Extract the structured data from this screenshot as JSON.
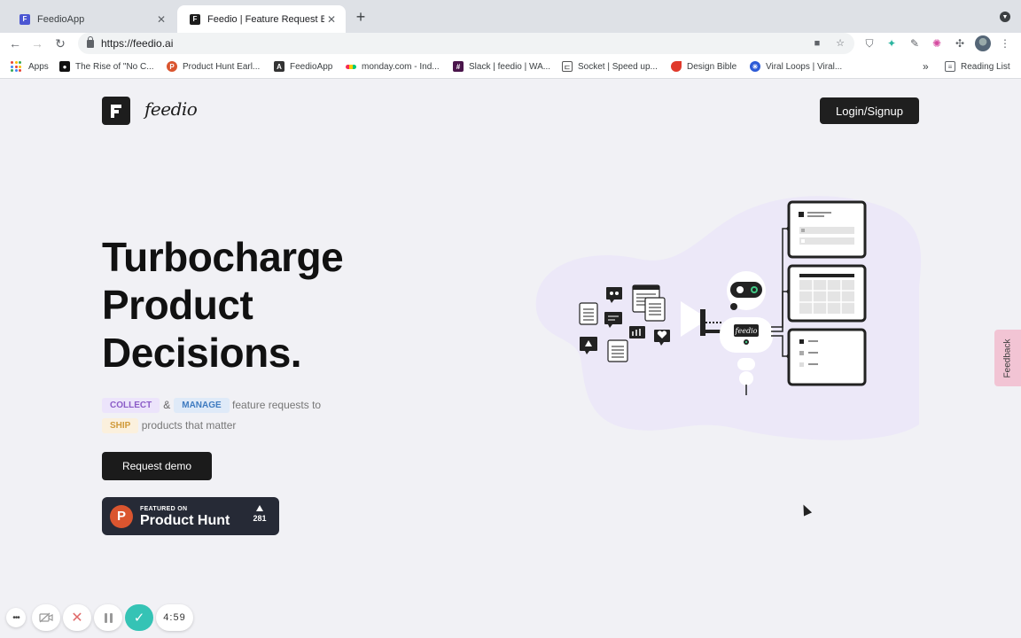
{
  "browser": {
    "tabs": [
      {
        "title": "FeedioApp",
        "active": false,
        "favicon_color": "#4b56d2"
      },
      {
        "title": "Feedio | Feature Request Board",
        "active": true,
        "favicon_color": "#1d1d1d"
      }
    ],
    "url": "https://feedio.ai",
    "bookmarks": [
      {
        "label": "Apps",
        "icon": "apps-grid-icon"
      },
      {
        "label": "The Rise of \"No C...",
        "icon": "video-icon",
        "color": "#111111"
      },
      {
        "label": "Product Hunt Earl...",
        "icon": "product-hunt-icon",
        "color": "#da552f",
        "glyph": "P"
      },
      {
        "label": "FeedioApp",
        "icon": "angular-icon",
        "color": "#333333",
        "glyph": "A"
      },
      {
        "label": "monday.com - Ind...",
        "icon": "monday-icon",
        "color": "#f62b54"
      },
      {
        "label": "Slack | feedio | WA...",
        "icon": "slack-icon",
        "color": "#4a154b"
      },
      {
        "label": "Socket | Speed up...",
        "icon": "socket-icon",
        "color": "#555555"
      },
      {
        "label": "Design Bible",
        "icon": "design-bible-icon",
        "color": "#e0392b"
      },
      {
        "label": "Viral Loops | Viral...",
        "icon": "viral-loops-icon",
        "color": "#2d5bd6"
      }
    ],
    "overflow_label": "»",
    "reading_list_label": "Reading List"
  },
  "header": {
    "logo_text": "feedio",
    "login_label": "Login/Signup"
  },
  "hero": {
    "lines": [
      "Turbocharge",
      "Product",
      "Decisions."
    ],
    "tag_collect": "COLLECT",
    "tag_amp": "&",
    "tag_manage": "MANAGE",
    "tag_text1": "feature requests to",
    "tag_ship": "SHIP",
    "tag_text2": "products that matter",
    "demo_label": "Request demo"
  },
  "product_hunt": {
    "small": "FEATURED ON",
    "big": "Product Hunt",
    "votes": "281",
    "glyph": "P"
  },
  "illustration": {
    "robot_label": "feedio"
  },
  "feedback_tab": {
    "label": "Feedback"
  },
  "recorder": {
    "more": "•••",
    "time": "4:59"
  },
  "colors": {
    "page_bg": "#f1f1f5",
    "dark": "#1d1d1d",
    "blob": "#ece8f8",
    "feedback_tab": "#f2c4d4",
    "record_check": "#35c3b5"
  }
}
